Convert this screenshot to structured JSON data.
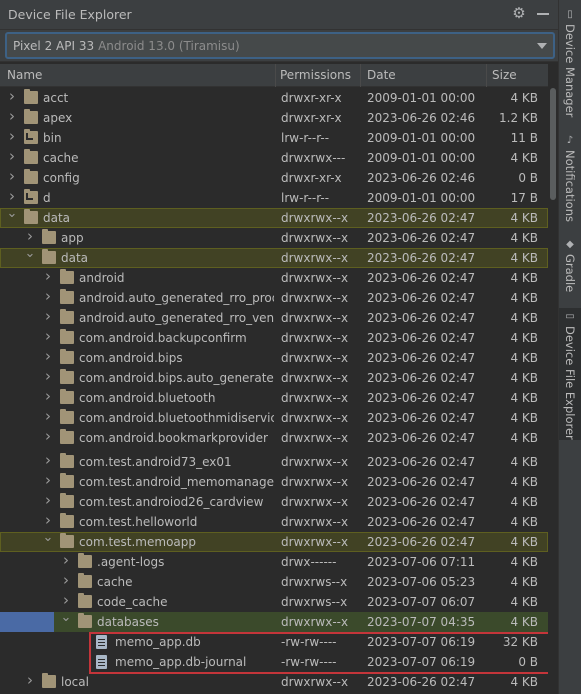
{
  "panel": {
    "title": "Device File Explorer"
  },
  "device": {
    "name": "Pixel 2 API 33",
    "os": "Android 13.0 (Tiramisu)"
  },
  "columns": {
    "name": "Name",
    "permissions": "Permissions",
    "date": "Date",
    "size": "Size"
  },
  "rows": [
    {
      "name": "acct",
      "perm": "drwxr-xr-x",
      "date": "2009-01-01 00:00",
      "size": "4 KB",
      "depth": 0,
      "type": "folder",
      "expanded": false
    },
    {
      "name": "apex",
      "perm": "drwxr-xr-x",
      "date": "2023-06-26 02:46",
      "size": "1.2 KB",
      "depth": 0,
      "type": "folder",
      "expanded": false
    },
    {
      "name": "bin",
      "perm": "lrw-r--r--",
      "date": "2009-01-01 00:00",
      "size": "11 B",
      "depth": 0,
      "type": "link",
      "expanded": false
    },
    {
      "name": "cache",
      "perm": "drwxrwx---",
      "date": "2009-01-01 00:00",
      "size": "4 KB",
      "depth": 0,
      "type": "folder",
      "expanded": false
    },
    {
      "name": "config",
      "perm": "drwxr-xr-x",
      "date": "2023-06-26 02:46",
      "size": "0 B",
      "depth": 0,
      "type": "folder",
      "expanded": false
    },
    {
      "name": "d",
      "perm": "lrw-r--r--",
      "date": "2009-01-01 00:00",
      "size": "17 B",
      "depth": 0,
      "type": "link",
      "expanded": false
    },
    {
      "name": "data",
      "perm": "drwxrwx--x",
      "date": "2023-06-26 02:47",
      "size": "4 KB",
      "depth": 0,
      "type": "folder",
      "expanded": true,
      "highlight": true
    },
    {
      "name": "app",
      "perm": "drwxrwx--x",
      "date": "2023-06-26 02:47",
      "size": "4 KB",
      "depth": 1,
      "type": "folder",
      "expanded": false
    },
    {
      "name": "data",
      "perm": "drwxrwx--x",
      "date": "2023-06-26 02:47",
      "size": "4 KB",
      "depth": 1,
      "type": "folder",
      "expanded": true,
      "highlight": true
    },
    {
      "name": "android",
      "perm": "drwxrwx--x",
      "date": "2023-06-26 02:47",
      "size": "4 KB",
      "depth": 2,
      "type": "folder",
      "expanded": false
    },
    {
      "name": "android.auto_generated_rro_product_",
      "perm": "drwxrwx--x",
      "date": "2023-06-26 02:47",
      "size": "4 KB",
      "depth": 2,
      "type": "folder",
      "expanded": false
    },
    {
      "name": "android.auto_generated_rro_vendor_",
      "perm": "drwxrwx--x",
      "date": "2023-06-26 02:47",
      "size": "4 KB",
      "depth": 2,
      "type": "folder",
      "expanded": false
    },
    {
      "name": "com.android.backupconfirm",
      "perm": "drwxrwx--x",
      "date": "2023-06-26 02:47",
      "size": "4 KB",
      "depth": 2,
      "type": "folder",
      "expanded": false
    },
    {
      "name": "com.android.bips",
      "perm": "drwxrwx--x",
      "date": "2023-06-26 02:47",
      "size": "4 KB",
      "depth": 2,
      "type": "folder",
      "expanded": false
    },
    {
      "name": "com.android.bips.auto_generated_rro",
      "perm": "drwxrwx--x",
      "date": "2023-06-26 02:47",
      "size": "4 KB",
      "depth": 2,
      "type": "folder",
      "expanded": false
    },
    {
      "name": "com.android.bluetooth",
      "perm": "drwxrwx--x",
      "date": "2023-06-26 02:47",
      "size": "4 KB",
      "depth": 2,
      "type": "folder",
      "expanded": false
    },
    {
      "name": "com.android.bluetoothmidiservice",
      "perm": "drwxrwx--x",
      "date": "2023-06-26 02:47",
      "size": "4 KB",
      "depth": 2,
      "type": "folder",
      "expanded": false
    },
    {
      "name": "com.android.bookmarkprovider",
      "perm": "drwxrwx--x",
      "date": "2023-06-26 02:47",
      "size": "4 KB",
      "depth": 2,
      "type": "folder",
      "expanded": false
    },
    {
      "name": "com.test.android73_ex01",
      "perm": "drwxrwx--x",
      "date": "2023-06-26 02:47",
      "size": "4 KB",
      "depth": 2,
      "type": "folder",
      "expanded": false,
      "gap": true
    },
    {
      "name": "com.test.android_memomanager",
      "perm": "drwxrwx--x",
      "date": "2023-06-26 02:47",
      "size": "4 KB",
      "depth": 2,
      "type": "folder",
      "expanded": false
    },
    {
      "name": "com.test.androiod26_cardview",
      "perm": "drwxrwx--x",
      "date": "2023-06-26 02:47",
      "size": "4 KB",
      "depth": 2,
      "type": "folder",
      "expanded": false
    },
    {
      "name": "com.test.helloworld",
      "perm": "drwxrwx--x",
      "date": "2023-06-26 02:47",
      "size": "4 KB",
      "depth": 2,
      "type": "folder",
      "expanded": false
    },
    {
      "name": "com.test.memoapp",
      "perm": "drwxrwx--x",
      "date": "2023-06-26 02:47",
      "size": "4 KB",
      "depth": 2,
      "type": "folder",
      "expanded": true,
      "highlight": true
    },
    {
      "name": ".agent-logs",
      "perm": "drwx------",
      "date": "2023-07-06 07:11",
      "size": "4 KB",
      "depth": 3,
      "type": "folder",
      "expanded": false
    },
    {
      "name": "cache",
      "perm": "drwxrws--x",
      "date": "2023-07-06 05:23",
      "size": "4 KB",
      "depth": 3,
      "type": "folder",
      "expanded": false
    },
    {
      "name": "code_cache",
      "perm": "drwxrws--x",
      "date": "2023-07-07 06:07",
      "size": "4 KB",
      "depth": 3,
      "type": "folder",
      "expanded": false
    },
    {
      "name": "databases",
      "perm": "drwxrwx--x",
      "date": "2023-07-07 04:35",
      "size": "4 KB",
      "depth": 3,
      "type": "folder",
      "expanded": true,
      "selected": true
    },
    {
      "name": "memo_app.db",
      "perm": "-rw-rw----",
      "date": "2023-07-07 06:19",
      "size": "32 KB",
      "depth": 4,
      "type": "file"
    },
    {
      "name": "memo_app.db-journal",
      "perm": "-rw-rw----",
      "date": "2023-07-07 06:19",
      "size": "0 B",
      "depth": 4,
      "type": "file"
    },
    {
      "name": "local",
      "perm": "drwxrwx--x",
      "date": "2023-06-26 02:47",
      "size": "4 KB",
      "depth": 1,
      "type": "folder",
      "expanded": false
    }
  ],
  "sidebar": {
    "tabs": [
      {
        "label": "Device Manager",
        "icon": "device-icon"
      },
      {
        "label": "Notifications",
        "icon": "bell-icon"
      },
      {
        "label": "Gradle",
        "icon": "elephant-icon"
      },
      {
        "label": "Device File Explorer",
        "icon": "file-explorer-icon",
        "active": true
      }
    ]
  },
  "colors": {
    "highlight_row": "#414224",
    "selected_row": "#3b4a2b",
    "selection_accent": "#4a6aa5",
    "annotation_box": "#c4353a"
  }
}
